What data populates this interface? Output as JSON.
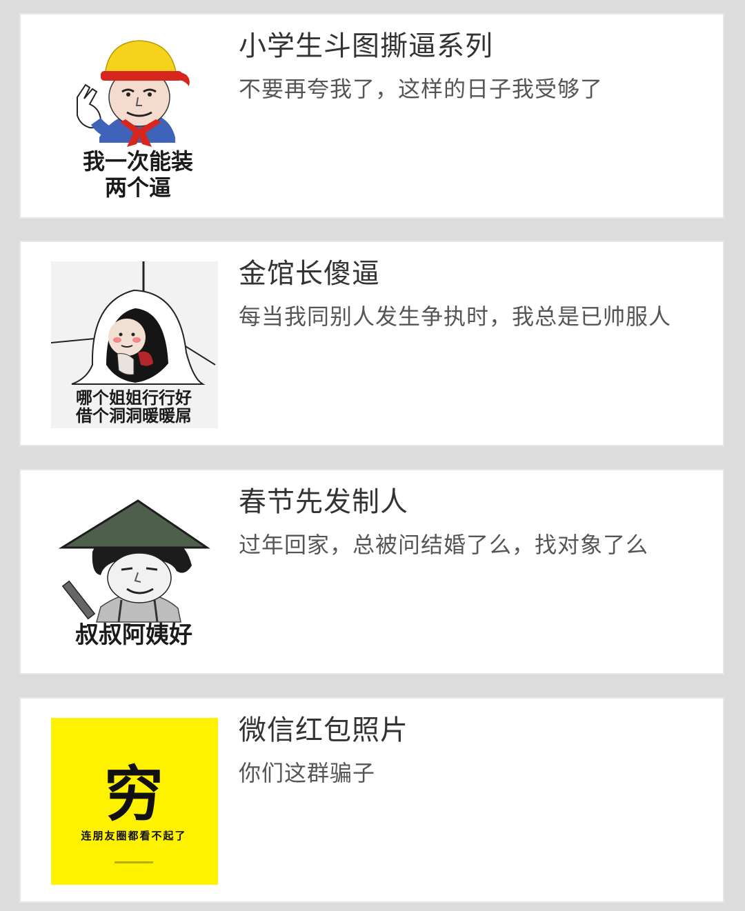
{
  "items": [
    {
      "title": "小学生斗图撕逼系列",
      "desc": "不要再夸我了，这样的日子我受够了",
      "thumb_caption_line1": "我一次能装",
      "thumb_caption_line2": "两个逼"
    },
    {
      "title": "金馆长傻逼",
      "desc": "每当我同别人发生争执时，我总是已帅服人",
      "thumb_caption_line1": "哪个姐姐行行好",
      "thumb_caption_line2": "借个洞洞暖暖屌"
    },
    {
      "title": "春节先发制人",
      "desc": "过年回家，总被问结婚了么，找对象了么",
      "thumb_caption_line1": "叔叔阿姨好"
    },
    {
      "title": "微信红包照片",
      "desc": "你们这群骗子",
      "thumb_big_char": "穷",
      "thumb_caption_line1": "连朋友圈都看不起了"
    }
  ],
  "colors": {
    "background": "#dcdcdc",
    "card": "#ffffff",
    "title": "#333333",
    "desc": "#555555",
    "meme_yellow": "#fff200",
    "helmet_yellow": "#f5d31c",
    "scarf_red": "#d7261e",
    "shirt_blue": "#3f63b8",
    "hat_green": "#4e5f4c"
  }
}
